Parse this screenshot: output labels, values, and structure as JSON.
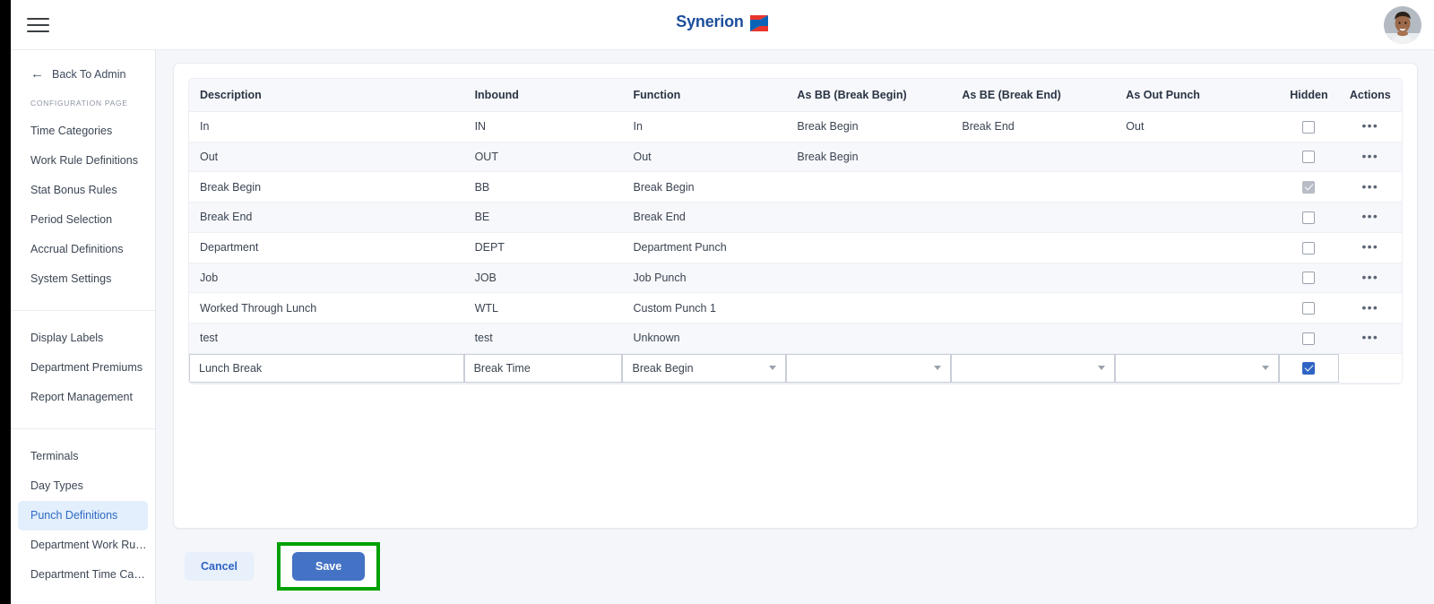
{
  "header": {
    "menu_icon": "hamburger-icon",
    "brand_name": "Synerion",
    "avatar_alt": "user-avatar"
  },
  "sidebar": {
    "back_label": "Back To Admin",
    "back_icon": "arrow-left-icon",
    "section_label": "CONFIGURATION PAGE",
    "groups": [
      {
        "items": [
          {
            "label": "Time Categories",
            "active": false
          },
          {
            "label": "Work Rule Definitions",
            "active": false
          },
          {
            "label": "Stat Bonus Rules",
            "active": false
          },
          {
            "label": "Period Selection",
            "active": false
          },
          {
            "label": "Accrual Definitions",
            "active": false
          },
          {
            "label": "System Settings",
            "active": false
          }
        ]
      },
      {
        "items": [
          {
            "label": "Display Labels",
            "active": false
          },
          {
            "label": "Department Premiums",
            "active": false
          },
          {
            "label": "Report Management",
            "active": false
          }
        ]
      },
      {
        "items": [
          {
            "label": "Terminals",
            "active": false
          },
          {
            "label": "Day Types",
            "active": false
          },
          {
            "label": "Punch Definitions",
            "active": true
          },
          {
            "label": "Department Work Rules Filt...",
            "active": false
          },
          {
            "label": "Department Time Category ...",
            "active": false
          }
        ]
      }
    ]
  },
  "table": {
    "columns": [
      "Description",
      "Inbound",
      "Function",
      "As BB (Break Begin)",
      "As BE (Break End)",
      "As Out Punch",
      "Hidden",
      "Actions"
    ],
    "rows": [
      {
        "description": "In",
        "inbound": "IN",
        "function": "In",
        "as_bb": "Break Begin",
        "as_be": "Break End",
        "as_out": "Out",
        "hidden": "unchecked",
        "actions": "•••"
      },
      {
        "description": "Out",
        "inbound": "OUT",
        "function": "Out",
        "as_bb": "Break Begin",
        "as_be": "",
        "as_out": "",
        "hidden": "unchecked",
        "actions": "•••"
      },
      {
        "description": "Break Begin",
        "inbound": "BB",
        "function": "Break Begin",
        "as_bb": "",
        "as_be": "",
        "as_out": "",
        "hidden": "checked-disabled",
        "actions": "•••"
      },
      {
        "description": "Break End",
        "inbound": "BE",
        "function": "Break End",
        "as_bb": "",
        "as_be": "",
        "as_out": "",
        "hidden": "unchecked",
        "actions": "•••"
      },
      {
        "description": "Department",
        "inbound": "DEPT",
        "function": "Department Punch",
        "as_bb": "",
        "as_be": "",
        "as_out": "",
        "hidden": "unchecked",
        "actions": "•••"
      },
      {
        "description": "Job",
        "inbound": "JOB",
        "function": "Job Punch",
        "as_bb": "",
        "as_be": "",
        "as_out": "",
        "hidden": "unchecked",
        "actions": "•••"
      },
      {
        "description": "Worked Through Lunch",
        "inbound": "WTL",
        "function": "Custom Punch 1",
        "as_bb": "",
        "as_be": "",
        "as_out": "",
        "hidden": "unchecked",
        "actions": "•••"
      },
      {
        "description": "test",
        "inbound": "test",
        "function": "Unknown",
        "as_bb": "",
        "as_be": "",
        "as_out": "",
        "hidden": "unchecked",
        "actions": "•••"
      }
    ],
    "edit_row": {
      "description_value": "Lunch Break",
      "description_placeholder": "",
      "inbound_value": "Break Time",
      "inbound_placeholder": "",
      "function_value": "Break Begin",
      "as_bb_value": "",
      "as_be_value": "",
      "as_out_value": "",
      "hidden": "checked-blue"
    }
  },
  "footer": {
    "cancel_label": "Cancel",
    "save_label": "Save"
  },
  "colors": {
    "brand_blue": "#1b4f9c",
    "accent_blue": "#3064c4",
    "save_button": "#4472c4",
    "highlight_green": "#00a000",
    "active_nav_bg": "#e3effc"
  }
}
